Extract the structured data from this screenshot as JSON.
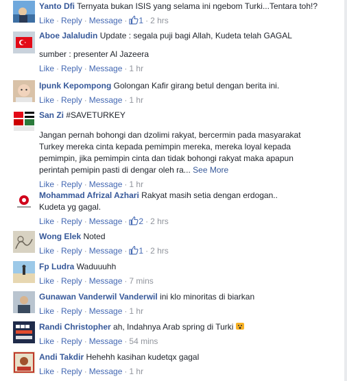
{
  "actions": {
    "like": "Like",
    "reply": "Reply",
    "message": "Message",
    "sep": "·"
  },
  "colors": {
    "link": "#4267b2",
    "author": "#365899",
    "meta": "#90949c"
  },
  "comments": [
    {
      "author": "Yanto Dfi",
      "lines": [
        "Ternyata bukan ISIS yang selama ini ngebom Turki...Tentara toh!?"
      ],
      "likes": "1",
      "time": "2 hrs",
      "avatar": "avatar-photo-sky"
    },
    {
      "author": "Aboe Jalaludin",
      "lines": [
        "Update : segala puji bagi Allah, Kudeta telah GAGAL",
        "",
        "sumber : presenter Al Jazeera"
      ],
      "likes": "",
      "time": "1 hr",
      "avatar": "avatar-photo-flag"
    },
    {
      "author": "Ipunk Kepompong",
      "lines": [
        "Golongan Kafir girang betul dengan berita ini."
      ],
      "likes": "",
      "time": "1 hr",
      "avatar": "avatar-photo-baby"
    },
    {
      "author": "San Zi",
      "lines": [
        "#SAVETURKEY",
        "",
        "Jangan pernah bohongi dan dzolimi rakyat, bercermin pada masyarakat",
        "Turkey mereka cinta kepada pemimpin mereka, mereka loyal kepada",
        "pemimpin, jika pemimpin cinta dan tidak bohongi rakyat maka apapun",
        "perintah pemipin pasti di dengar oleh ra..."
      ],
      "see_more": "See More",
      "likes": "",
      "time": "1 hr",
      "avatar": "avatar-photo-flags"
    },
    {
      "author": "Mohammad Afrizal Azhari",
      "lines": [
        "Rakyat masih setia dengan erdogan..",
        "Kudeta yg gagal."
      ],
      "likes": "2",
      "time": "2 hrs",
      "avatar": "avatar-logo-red"
    },
    {
      "author": "Wong Elek",
      "lines": [
        "Noted"
      ],
      "likes": "1",
      "time": "2 hrs",
      "avatar": "avatar-photo-drawing"
    },
    {
      "author": "Fp Ludra",
      "lines": [
        "Waduuuhh"
      ],
      "likes": "",
      "time": "7 mins",
      "avatar": "avatar-photo-beach"
    },
    {
      "author": "Gunawan Vanderwil Vanderwil",
      "lines": [
        "ini klo minoritas di biarkan"
      ],
      "likes": "",
      "time": "1 hr",
      "avatar": "avatar-photo-man"
    },
    {
      "author": "Randi Christopher",
      "lines": [
        "ah, Indahnya Arab spring di Turki"
      ],
      "likes": "",
      "time": "54 mins",
      "reaction": "wow-icon",
      "avatar": "avatar-turn-back-crime"
    },
    {
      "author": "Andi Takdir",
      "lines": [
        "Hehehh kasihan kudetqx gagal"
      ],
      "likes": "",
      "time": "1 hr",
      "avatar": "avatar-photo-poster"
    }
  ]
}
